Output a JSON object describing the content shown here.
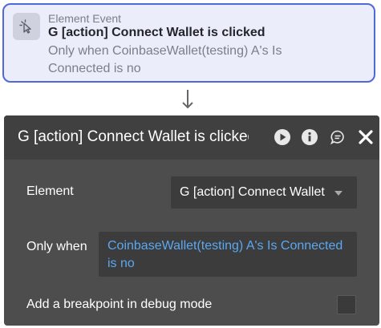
{
  "event": {
    "kind_label": "Element Event",
    "title": "G [action] Connect Wallet is clicked",
    "condition": "Only when CoinbaseWallet(testing) A's Is Connected is no",
    "icon": "cursor-click-icon"
  },
  "panel": {
    "title": "G [action] Connect Wallet is clicked",
    "header_icons": [
      "play-icon",
      "info-icon",
      "comment-icon",
      "close-icon"
    ],
    "element_label": "Element",
    "element_value": "G [action] Connect Wallet",
    "only_when_label": "Only when",
    "only_when_value": "CoinbaseWallet(testing) A's Is Connected is no",
    "breakpoint_label": "Add a breakpoint in debug mode",
    "breakpoint_checked": false
  },
  "colors": {
    "accent": "#5068d8",
    "event_bg": "#ebedfb",
    "panel_bg": "#4d4d4d",
    "panel_header_bg": "#404040",
    "link_blue": "#5aa8f2"
  }
}
